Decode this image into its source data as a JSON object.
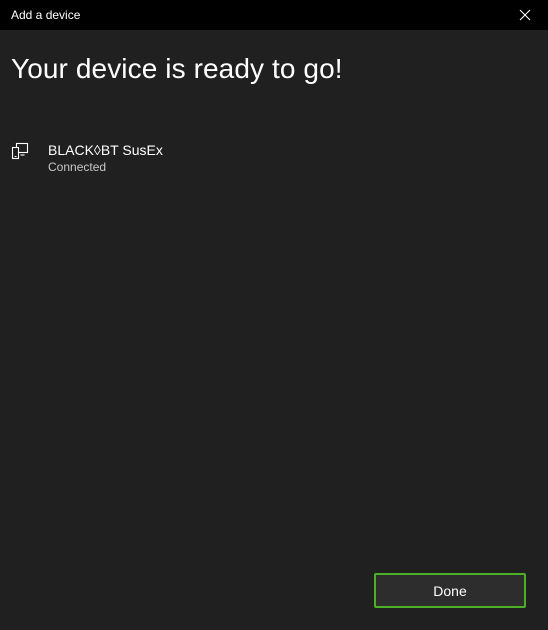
{
  "window": {
    "title": "Add a device",
    "close_icon": "close-icon"
  },
  "main": {
    "heading": "Your device is ready to go!",
    "devices": [
      {
        "name": "BLACK◊BT SusEx",
        "status": "Connected",
        "icon": "device-icon"
      }
    ]
  },
  "footer": {
    "done_label": "Done"
  },
  "colors": {
    "background": "#202020",
    "titlebar": "#000000",
    "accent_border": "#4caf27",
    "button_bg": "#2d2d2d"
  }
}
